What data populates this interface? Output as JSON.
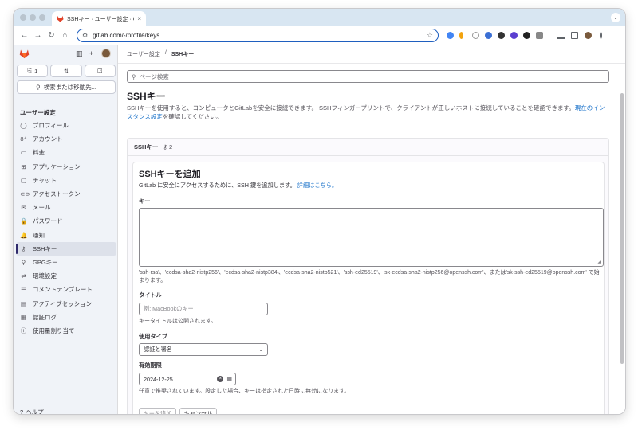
{
  "browser": {
    "tab_title": "SSHキー · ユーザー設定 · GitLab",
    "tab_close": "×",
    "new_tab": "+",
    "url": "gitlab.com/-/profile/keys"
  },
  "sidebar": {
    "counters": [
      {
        "icon": "issues-icon",
        "glyph": "⎘",
        "value": "1"
      },
      {
        "icon": "merge-request-icon",
        "glyph": "⇅",
        "value": ""
      },
      {
        "icon": "todo-icon",
        "glyph": "☑",
        "value": ""
      }
    ],
    "search_label": "検索または移動先...",
    "section_title": "ユーザー設定",
    "items": [
      {
        "label": "プロフィール",
        "glyph": "◯",
        "active": false
      },
      {
        "label": "アカウント",
        "glyph": "8⁺",
        "active": false
      },
      {
        "label": "料金",
        "glyph": "▭",
        "active": false
      },
      {
        "label": "アプリケーション",
        "glyph": "⊞",
        "active": false
      },
      {
        "label": "チャット",
        "glyph": "▢",
        "active": false
      },
      {
        "label": "アクセストークン",
        "glyph": "⊂⊃",
        "active": false
      },
      {
        "label": "メール",
        "glyph": "✉",
        "active": false
      },
      {
        "label": "パスワード",
        "glyph": "🔒",
        "active": false
      },
      {
        "label": "通知",
        "glyph": "🔔",
        "active": false
      },
      {
        "label": "SSHキー",
        "glyph": "⚷",
        "active": true
      },
      {
        "label": "GPGキー",
        "glyph": "⚲",
        "active": false
      },
      {
        "label": "環境設定",
        "glyph": "⇌",
        "active": false
      },
      {
        "label": "コメントテンプレート",
        "glyph": "☰",
        "active": false
      },
      {
        "label": "アクティブセッション",
        "glyph": "▤",
        "active": false
      },
      {
        "label": "認証ログ",
        "glyph": "▦",
        "active": false
      },
      {
        "label": "使用量割り当て",
        "glyph": "ⓘ",
        "active": false
      }
    ],
    "help_label": "ヘルプ"
  },
  "main": {
    "breadcrumb": [
      "ユーザー設定",
      "/",
      "SSHキー"
    ],
    "page_search_placeholder": "ページ検索",
    "title": "SSHキー",
    "description": "SSHキーを使用すると、コンピュータとGitLabを安全に接続できます。 SSHフィンガープリントで、クライアントが正しいホストに接続していることを確認できます。",
    "description_link": "現在のインスタンス設定",
    "description_tail": "を確認してください。",
    "card_title": "SSHキー",
    "card_count": "2",
    "form": {
      "title": "SSHキーを追加",
      "subtitle": "GitLab に安全にアクセスするために、SSH 鍵を追加します。",
      "subtitle_link": "詳細はこちら。",
      "key_label": "キー",
      "key_value": "",
      "key_hint": "'ssh-rsa'、'ecdsa-sha2-nistp256'、'ecdsa-sha2-nistp384'、'ecdsa-sha2-nistp521'、'ssh-ed25519'、'sk-ecdsa-sha2-nistp256@openssh.com'、または'sk-ssh-ed25519@openssh.com' で始まります。",
      "title_label": "タイトル",
      "title_placeholder": "例: MacBookのキー",
      "title_hint": "キータイトルは公開されます。",
      "usage_label": "使用タイプ",
      "usage_value": "認証と署名",
      "expiry_label": "有効期限",
      "expiry_value": "2024-12-25",
      "expiry_hint": "任意で推奨されています。設定した場合、キーは指定された日時に無効になります。",
      "add_button": "キーを追加",
      "cancel_button": "キャンセル"
    }
  }
}
